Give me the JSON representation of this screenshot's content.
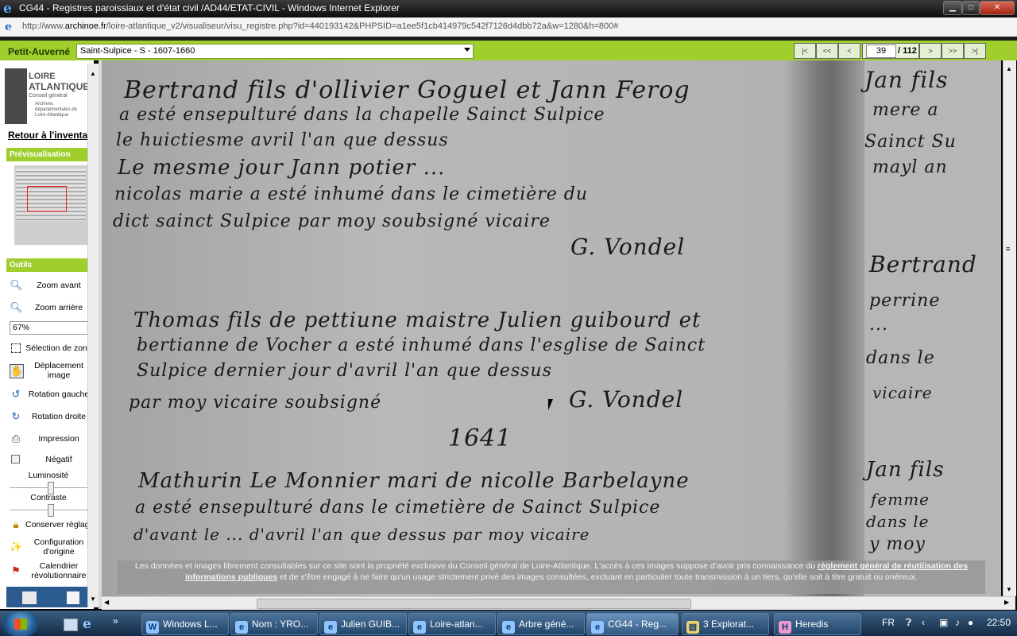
{
  "window": {
    "title": "CG44 - Registres paroissiaux et d'état civil /AD44/ETAT-CIVIL - Windows Internet Explorer",
    "url_prefix": "http://www.",
    "url_domain": "archinoe.fr",
    "url_rest": "/loire-atlantique_v2/visualiseur/visu_registre.php?id=440193142&PHPSID=a1ee5f1cb414979c542f7126d4dbb72a&w=1280&h=800#"
  },
  "viewer": {
    "commune": "Petit-Auverné",
    "register": "Saint-Sulpice - S - 1607-1660",
    "nav": {
      "first": "|<",
      "prev_block": "<<",
      "prev": "<",
      "next": ">",
      "next_block": ">>",
      "last": ">|"
    },
    "page_current": "39",
    "page_total": "/ 112"
  },
  "sidebar": {
    "logo": {
      "line1": "LOIRE",
      "line2": "ATLANTIQUE",
      "line3": "Conseil général",
      "line4": "Archives départementales de Loire-Atlantique"
    },
    "back_link": "Retour à l'inventaire",
    "preview_header": "Prévisualisation",
    "tools_header": "Outils",
    "tools": {
      "zoom_in": "Zoom avant",
      "zoom_out": "Zoom arrière",
      "zoom_value": "67%",
      "zone_select": "Sélection de zone",
      "pan": "Déplacement image",
      "rotate_left": "Rotation gauche",
      "rotate_right": "Rotation droite",
      "print": "Impression",
      "negative": "Négatif",
      "brightness": "Luminosité",
      "contrast": "Contraste",
      "keep_settings": "Conserver réglages",
      "default_config": "Configuration d'origine",
      "calendar": "Calendrier révolutionnaire"
    }
  },
  "document": {
    "lines": [
      "Bertrand fils d'ollivier Goguel et Jann Ferog",
      "a esté ensepulturé dans la chapelle Sainct Sulpice",
      "le huictiesme avril l'an que dessus",
      "Le mesme jour Jann potier ...",
      "nicolas marie a esté inhumé dans le cimetière du",
      "dict sainct Sulpice par moy soubsigné vicaire",
      "G. Vondel",
      "Thomas fils de pettiune maistre Julien guibourd et",
      "bertianne de Vocher a esté inhumé dans l'esglise de Sainct",
      "Sulpice dernier jour d'avril l'an que dessus",
      "par moy vicaire soubsigné",
      "G. Vondel",
      "1641",
      "Mathurin Le Monnier mari de nicolle Barbelayne",
      "a esté ensepulturé dans le cimetière de Sainct Sulpice",
      "d'avant le ... d'avril l'an que dessus par moy vicaire"
    ],
    "right_lines": [
      "Jan fils",
      "mere a",
      "Sainct Su",
      "mayl an",
      "Bertrand",
      "perrine",
      "... ",
      "dans le",
      "vicaire",
      "Jan fils",
      "femme",
      "dans le",
      "y moy"
    ],
    "legal_text_1": "Les données et images librement consultables sur ce site sont la propriété exclusive du Conseil général de Loire-Atlantique. L'accès à ces images suppose d'avoir pris connaissance du ",
    "legal_link": "règlement général de réutilisation des informations publiques",
    "legal_text_2": " et de s'être engagé à ne faire qu'un usage strictement privé des images consultées, excluant en particulier toute transmission à un tiers, qu'elle soit à titre gratuit ou onéreux."
  },
  "taskbar": {
    "items": [
      "Windows L...",
      "Nom : YRO...",
      "Julien GUIB...",
      "Loire-atlan...",
      "Arbre géné...",
      "CG44 - Reg...",
      "3 Explorat...",
      "Heredis"
    ],
    "lang": "FR",
    "clock": "22:50"
  },
  "colors": {
    "accent_green": "#9fce2d",
    "title_dark": "#1a1a1a"
  }
}
